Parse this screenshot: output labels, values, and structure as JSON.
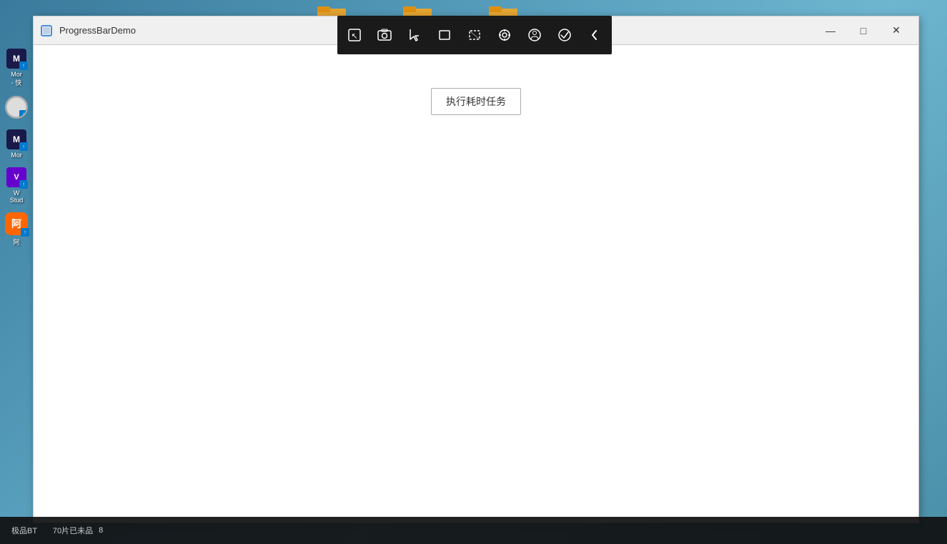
{
  "desktop": {
    "background_color": "#4a8fa8"
  },
  "toolbar": {
    "buttons": [
      {
        "id": "pointer",
        "symbol": "↖",
        "title": "Pointer",
        "active": false
      },
      {
        "id": "camera",
        "symbol": "⬛",
        "title": "Camera",
        "active": false
      },
      {
        "id": "select",
        "symbol": "↖",
        "title": "Select",
        "active": false
      },
      {
        "id": "rect",
        "symbol": "▭",
        "title": "Rectangle",
        "active": false
      },
      {
        "id": "region",
        "symbol": "⬚",
        "title": "Region",
        "active": false
      },
      {
        "id": "target",
        "symbol": "⊕",
        "title": "Target",
        "active": false
      },
      {
        "id": "person",
        "symbol": "⊙",
        "title": "Person",
        "active": false
      },
      {
        "id": "check",
        "symbol": "✓",
        "title": "Check",
        "active": false
      },
      {
        "id": "back",
        "symbol": "‹",
        "title": "Back",
        "active": false
      }
    ]
  },
  "app_window": {
    "title": "ProgressBarDemo",
    "icon": "square",
    "controls": {
      "minimize": "—",
      "maximize": "□",
      "close": "✕"
    },
    "content": {
      "execute_button_label": "执行耗时任务"
    }
  },
  "left_icons": [
    {
      "id": "item1",
      "label": "Mor\n- 快",
      "color": "#1a1a4a",
      "has_badge": true
    },
    {
      "id": "item2",
      "label": "",
      "color": "#cccccc",
      "has_badge": true
    },
    {
      "id": "item3",
      "label": "Mor",
      "color": "#1a1a4a",
      "has_badge": true
    },
    {
      "id": "item4",
      "label": "W\nStud",
      "color": "#6600cc",
      "has_badge": true
    },
    {
      "id": "item5",
      "label": "阿",
      "color": "#ff6600",
      "has_badge": true
    }
  ],
  "taskbar_bottom": {
    "text": "极品BT   70片已未品\n8"
  },
  "desktop_folders": [
    {
      "color": "#f5a623"
    },
    {
      "color": "#f5a623"
    },
    {
      "color": "#f5a623"
    }
  ]
}
